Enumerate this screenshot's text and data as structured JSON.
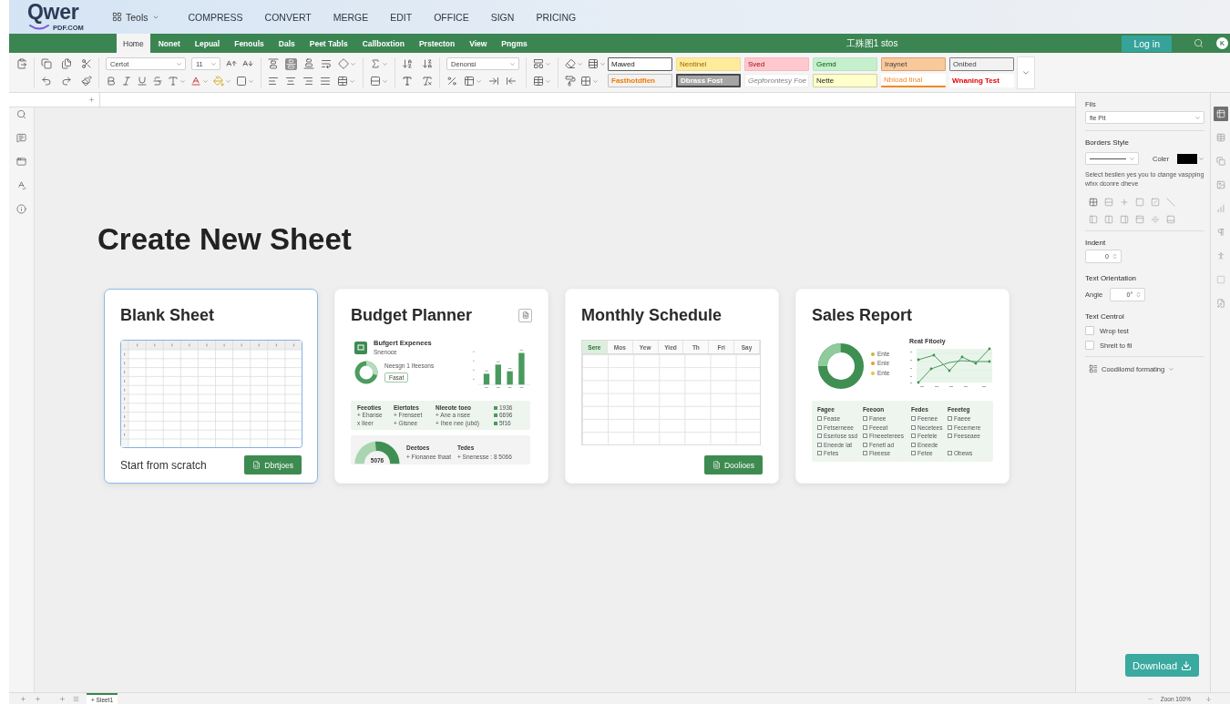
{
  "header": {
    "logo": "Qwer",
    "logo_domain": "PDF.COM",
    "tools_menu": "Teols",
    "nav": [
      "COMPRESS",
      "CONVERT",
      "MERGE",
      "EDIT",
      "OFFICE",
      "SIGN",
      "PRICING"
    ]
  },
  "ribbon": {
    "tabs": [
      {
        "label": "Home",
        "selected": true
      },
      {
        "label": "Nonet",
        "selected": false
      },
      {
        "label": "Lepual",
        "selected": false
      },
      {
        "label": "Fenouls",
        "selected": false
      },
      {
        "label": "Dals",
        "selected": false
      },
      {
        "label": "Peet Tabls",
        "selected": false
      },
      {
        "label": "Callboxtion",
        "selected": false
      },
      {
        "label": "Prstecton",
        "selected": false
      },
      {
        "label": "View",
        "selected": false
      },
      {
        "label": "Pngms",
        "selected": false
      }
    ],
    "title": "工殊图1 stos",
    "login": "Log in",
    "avatar": "K"
  },
  "toolbar": {
    "font": "Certot",
    "font_size": "11",
    "number_format": "Denonsi",
    "middle_align_selected": true,
    "cell_styles": [
      {
        "label": "Mawed",
        "kind": "normal"
      },
      {
        "label": "Nentinel",
        "kind": "neutral"
      },
      {
        "label": "Sved",
        "kind": "bad"
      },
      {
        "label": "Gemd",
        "kind": "good"
      },
      {
        "label": "Iraynet",
        "kind": "input"
      },
      {
        "label": "Onibed",
        "kind": "output"
      },
      {
        "label": "Fasthotdfien",
        "kind": "calculation"
      },
      {
        "label": "Dbrass Fost",
        "kind": "check"
      },
      {
        "label": "Gepforontesy Foe",
        "kind": "explanatory"
      },
      {
        "label": "Nette",
        "kind": "note"
      },
      {
        "label": "Nbload tinal",
        "kind": "linked"
      },
      {
        "label": "Wnaning Test",
        "kind": "warning"
      }
    ]
  },
  "main": {
    "heading": "Create New Sheet",
    "cards": [
      {
        "kind": "blank",
        "title": "Blank Sheet",
        "selected": true,
        "caption": "Start from scratch",
        "button": "Dbrtjoes"
      },
      {
        "kind": "budget",
        "title": "Budget Planner",
        "selected": false,
        "preview": {
          "heading": "Bufgert Expenees",
          "subheading": "Snenoce",
          "donut_caption": "Neesgn 1 Ifeesons",
          "tag": "Fasat",
          "summary": [
            {
              "title": "Feeoties",
              "lines": [
                "+ Ehanse",
                "x Ileer"
              ]
            },
            {
              "title": "Elertotes",
              "lines": [
                "+ Frenseet",
                "+ Gisnee"
              ]
            },
            {
              "title": "Nleeote toeo",
              "lines": [
                "+ Ane a nsee",
                "+ Ihee nee (ubd)"
              ]
            }
          ],
          "values": [
            "1936",
            "6696",
            "5f16"
          ],
          "gauge": "5076",
          "details": [
            {
              "title": "Deetoes",
              "line": "+ Fionanee thaat"
            },
            {
              "title": "Tedes",
              "line": "+ Snenesse : 8 5066"
            }
          ]
        }
      },
      {
        "kind": "schedule",
        "title": "Monthly Schedule",
        "selected": false,
        "days": [
          {
            "label": "Sere",
            "selected": true
          },
          {
            "label": "Mos",
            "selected": false
          },
          {
            "label": "Yew",
            "selected": false
          },
          {
            "label": "Yied",
            "selected": false
          },
          {
            "label": "Th",
            "selected": false
          },
          {
            "label": "Fri",
            "selected": false
          },
          {
            "label": "Say",
            "selected": false
          }
        ],
        "button": "Doolioes"
      },
      {
        "kind": "sales",
        "title": "Sales Report",
        "selected": false,
        "legend": [
          {
            "label": "Ente",
            "color": "#c7b53b"
          },
          {
            "label": "Enie",
            "color": "#e59b2e"
          },
          {
            "label": "Ente",
            "color": "#e6c24a"
          }
        ],
        "chart_title": "Reat Fitoeiy",
        "table": {
          "columns": [
            "Fagee",
            "Feeoon",
            "Fedes",
            "Feeeteg"
          ],
          "rows": [
            [
              {
                "label": "Fease",
                "checked": false
              },
              {
                "label": "Fanee",
                "checked": false
              },
              {
                "label": "Feenee",
                "checked": false
              },
              {
                "label": "Faeee",
                "checked": false
              }
            ],
            [
              {
                "label": "Fetserneee",
                "checked": false
              },
              {
                "label": "Feeeat",
                "checked": false
              },
              {
                "label": "Necetees",
                "checked": false
              },
              {
                "label": "Fecemere",
                "checked": false
              }
            ],
            [
              {
                "label": "Eseriose ssd",
                "checked": false
              },
              {
                "label": "Fineeeterees",
                "checked": false
              },
              {
                "label": "Feetele",
                "checked": false
              },
              {
                "label": "Feeseaee",
                "checked": false
              }
            ],
            [
              {
                "label": "Eneede lat",
                "checked": false
              },
              {
                "label": "Fenetl ad",
                "checked": false
              },
              {
                "label": "Eneede",
                "checked": false
              }
            ],
            [
              {
                "label": "Fetes",
                "checked": false
              },
              {
                "label": "Fieeese",
                "checked": false
              },
              {
                "label": "Fetee",
                "checked": false
              },
              {
                "label": "Obews",
                "checked": false
              }
            ]
          ]
        }
      }
    ]
  },
  "format_panel": {
    "fill_label": "Fils",
    "fill_value": "fle Pit",
    "borders_title": "Borders Style",
    "color_label": "Coler",
    "hint": "Select beslien yes you to ctange vaspping wfxx dconre dheve",
    "indent_label": "Indent",
    "indent_value": "0",
    "orientation_title": "Text Orientation",
    "angle_label": "Angie",
    "angle_value": "0°",
    "text_control_title": "Text Centrol",
    "text_control": [
      {
        "label": "Wrop test",
        "checked": false
      },
      {
        "label": "Shreit to fil",
        "checked": false
      }
    ],
    "conditional_formatting": "Coodilomd formating",
    "download": "Download"
  },
  "panel_tabs": [
    {
      "selected": true
    },
    {
      "selected": false
    },
    {
      "selected": false
    },
    {
      "selected": false
    },
    {
      "selected": false
    },
    {
      "selected": false
    },
    {
      "selected": false
    },
    {
      "selected": false
    },
    {
      "selected": false
    }
  ],
  "status_bar": {
    "sheet_tabs": [
      {
        "label": "+ Sleet1",
        "selected": true
      }
    ],
    "zoom": "Zoon 100%"
  }
}
